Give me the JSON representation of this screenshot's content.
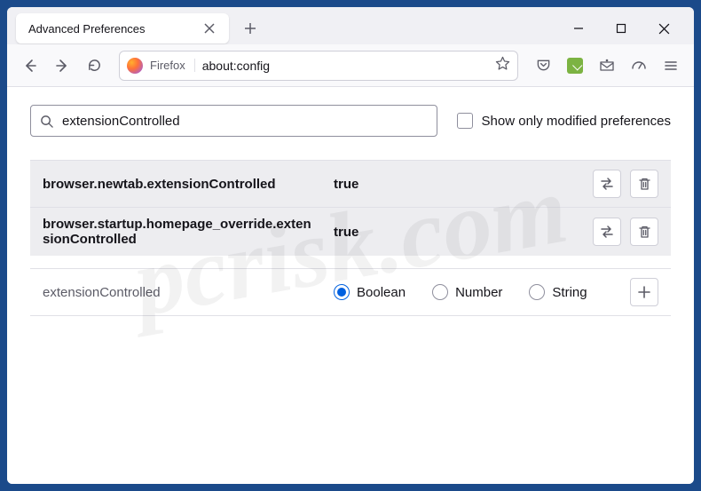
{
  "window": {
    "tab_title": "Advanced Preferences"
  },
  "toolbar": {
    "identity_label": "Firefox",
    "url": "about:config"
  },
  "search": {
    "value": "extensionControlled",
    "modified_only_label": "Show only modified preferences"
  },
  "prefs": [
    {
      "name": "browser.newtab.extensionControlled",
      "value": "true",
      "modified": true
    },
    {
      "name": "browser.startup.homepage_override.extensionControlled",
      "value": "true",
      "modified": true
    }
  ],
  "new_pref": {
    "name": "extensionControlled",
    "types": {
      "boolean": "Boolean",
      "number": "Number",
      "string": "String"
    },
    "selected": "boolean"
  },
  "watermark": "pcrisk.com"
}
